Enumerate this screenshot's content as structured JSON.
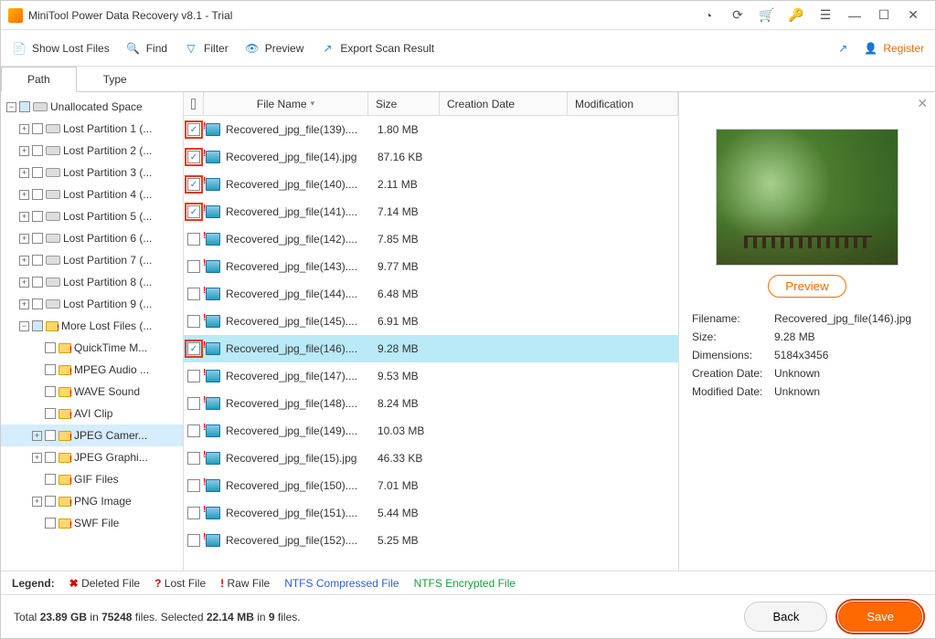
{
  "window": {
    "title": "MiniTool Power Data Recovery v8.1 - Trial"
  },
  "toolbar": {
    "show_lost": "Show Lost Files",
    "find": "Find",
    "filter": "Filter",
    "preview": "Preview",
    "export": "Export Scan Result",
    "register": "Register"
  },
  "tabs": {
    "path": "Path",
    "type": "Type"
  },
  "tree": {
    "root": "Unallocated Space",
    "partitions": [
      "Lost Partition 1 (...",
      "Lost Partition 2 (...",
      "Lost Partition 3 (...",
      "Lost Partition 4 (...",
      "Lost Partition 5 (...",
      "Lost Partition 6 (...",
      "Lost Partition 7 (...",
      "Lost Partition 8 (...",
      "Lost Partition 9 (..."
    ],
    "more": "More Lost Files (...",
    "subs": [
      "QuickTime M...",
      "MPEG Audio ...",
      "WAVE Sound",
      "AVI Clip",
      "JPEG Camer...",
      "JPEG Graphi...",
      "GIF Files",
      "PNG Image",
      "SWF File"
    ]
  },
  "columns": {
    "name": "File Name",
    "size": "Size",
    "cdate": "Creation Date",
    "mod": "Modification"
  },
  "files": [
    {
      "name": "Recovered_jpg_file(139)....",
      "size": "1.80 MB",
      "chk": true,
      "hl": true
    },
    {
      "name": "Recovered_jpg_file(14).jpg",
      "size": "87.16 KB",
      "chk": true,
      "hl": true
    },
    {
      "name": "Recovered_jpg_file(140)....",
      "size": "2.11 MB",
      "chk": true,
      "hl": true
    },
    {
      "name": "Recovered_jpg_file(141)....",
      "size": "7.14 MB",
      "chk": true,
      "hl": true
    },
    {
      "name": "Recovered_jpg_file(142)....",
      "size": "7.85 MB",
      "chk": false,
      "hl": false
    },
    {
      "name": "Recovered_jpg_file(143)....",
      "size": "9.77 MB",
      "chk": false,
      "hl": false
    },
    {
      "name": "Recovered_jpg_file(144)....",
      "size": "6.48 MB",
      "chk": false,
      "hl": false
    },
    {
      "name": "Recovered_jpg_file(145)....",
      "size": "6.91 MB",
      "chk": false,
      "hl": false
    },
    {
      "name": "Recovered_jpg_file(146)....",
      "size": "9.28 MB",
      "chk": true,
      "hl": true,
      "sel": true
    },
    {
      "name": "Recovered_jpg_file(147)....",
      "size": "9.53 MB",
      "chk": false,
      "hl": false
    },
    {
      "name": "Recovered_jpg_file(148)....",
      "size": "8.24 MB",
      "chk": false,
      "hl": false
    },
    {
      "name": "Recovered_jpg_file(149)....",
      "size": "10.03 MB",
      "chk": false,
      "hl": false
    },
    {
      "name": "Recovered_jpg_file(15).jpg",
      "size": "46.33 KB",
      "chk": false,
      "hl": false
    },
    {
      "name": "Recovered_jpg_file(150)....",
      "size": "7.01 MB",
      "chk": false,
      "hl": false
    },
    {
      "name": "Recovered_jpg_file(151)....",
      "size": "5.44 MB",
      "chk": false,
      "hl": false
    },
    {
      "name": "Recovered_jpg_file(152)....",
      "size": "5.25 MB",
      "chk": false,
      "hl": false
    }
  ],
  "preview": {
    "btn": "Preview",
    "labels": {
      "fn": "Filename:",
      "sz": "Size:",
      "dim": "Dimensions:",
      "cd": "Creation Date:",
      "md": "Modified Date:"
    },
    "filename": "Recovered_jpg_file(146).jpg",
    "size": "9.28 MB",
    "dimensions": "5184x3456",
    "cdate": "Unknown",
    "mdate": "Unknown"
  },
  "legend": {
    "title": "Legend:",
    "deleted": "Deleted File",
    "lost": "Lost File",
    "raw": "Raw File",
    "ntfs": "NTFS Compressed File",
    "enc": "NTFS Encrypted File"
  },
  "footer": {
    "stats_pre": "Total ",
    "total_size": "23.89 GB",
    "stats_mid1": " in ",
    "total_files": "75248",
    "stats_mid2": " files.  Selected ",
    "sel_size": "22.14 MB",
    "stats_mid3": " in ",
    "sel_files": "9",
    "stats_end": " files.",
    "back": "Back",
    "save": "Save"
  }
}
